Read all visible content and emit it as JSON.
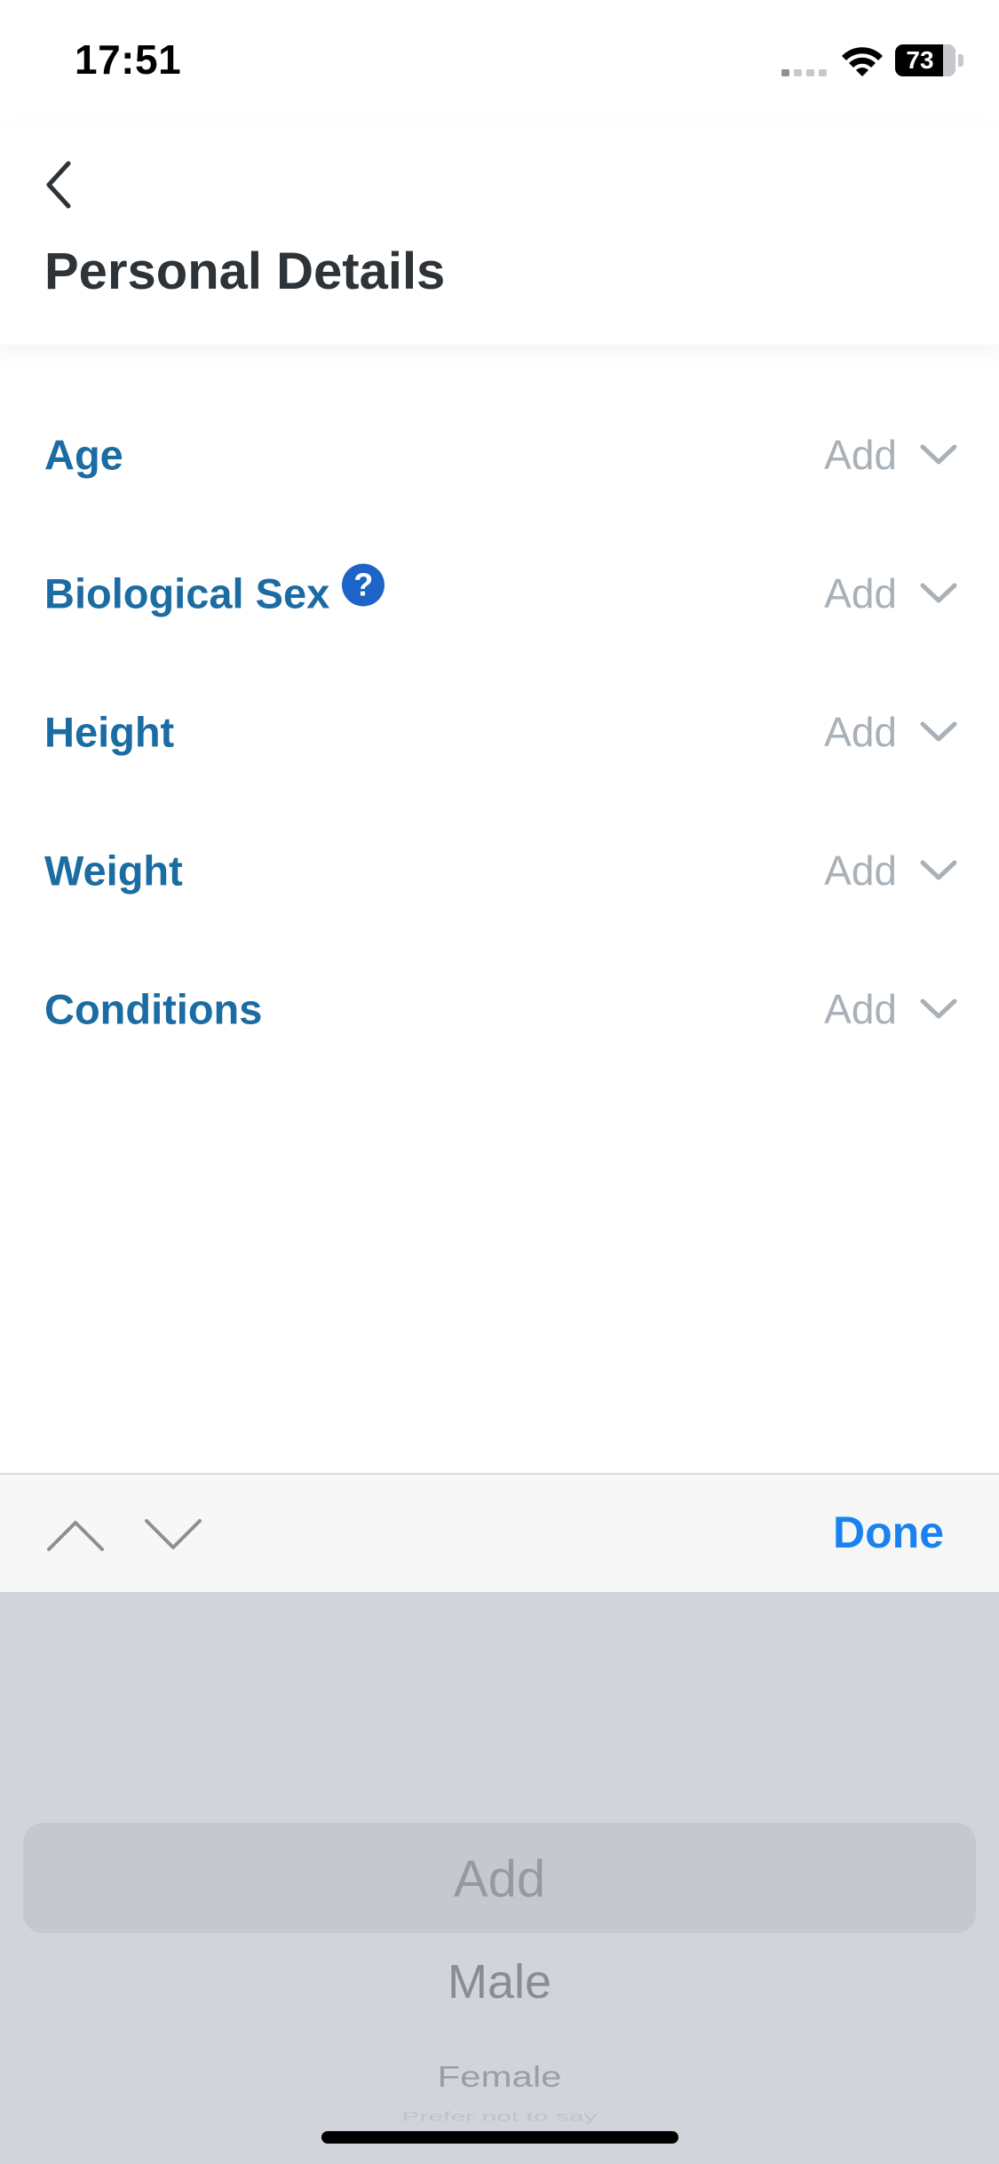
{
  "status_bar": {
    "time": "17:51",
    "battery_level": "73",
    "icons": [
      "cellular-signal-icon",
      "wifi-icon",
      "battery-icon"
    ]
  },
  "header": {
    "back_icon": "chevron-left-icon",
    "title": "Personal Details"
  },
  "rows": [
    {
      "label": "Age",
      "value": "Add",
      "icon": "chevron-down-icon"
    },
    {
      "label": "Biological Sex",
      "value": "Add",
      "icon": "chevron-down-icon",
      "help_icon": "?"
    },
    {
      "label": "Height",
      "value": "Add",
      "icon": "chevron-down-icon"
    },
    {
      "label": "Weight",
      "value": "Add",
      "icon": "chevron-down-icon"
    },
    {
      "label": "Conditions",
      "value": "Add",
      "icon": "chevron-down-icon"
    }
  ],
  "toolbar": {
    "up_icon": "chevron-up-icon",
    "down_icon": "chevron-down-icon",
    "done_label": "Done"
  },
  "picker": {
    "selected": "Add",
    "options": [
      "Add",
      "Male",
      "Female",
      "Prefer not to say"
    ]
  },
  "colors": {
    "label": "#1a6ca3",
    "value": "#a9b1b8",
    "accent": "#1a82f0",
    "help_badge": "#1d64c9",
    "picker_bg": "#d1d4db"
  }
}
